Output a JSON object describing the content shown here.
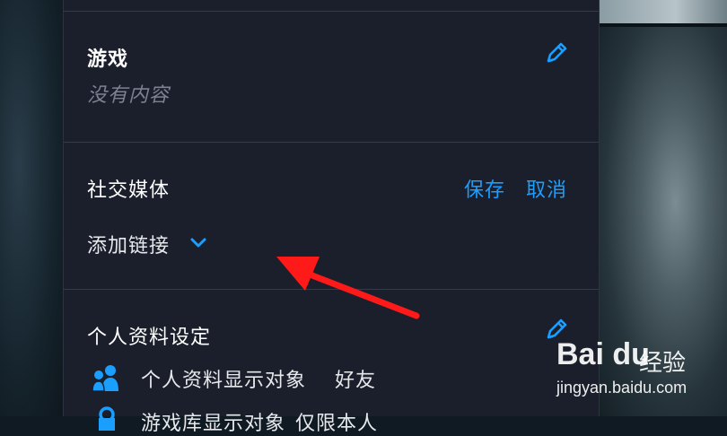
{
  "games": {
    "title": "游戏",
    "empty_text": "没有内容"
  },
  "social_media": {
    "title": "社交媒体",
    "save_label": "保存",
    "cancel_label": "取消",
    "add_link_label": "添加链接"
  },
  "profile_settings": {
    "title": "个人资料设定",
    "visibility_label": "个人资料显示对象",
    "visibility_value": "好友",
    "inventory_label": "游戏库显示对象",
    "inventory_value": "仅限本人"
  },
  "watermark": {
    "logo": "Bai du",
    "sub": "经验",
    "url": "jingyan.baidu.com"
  },
  "colors": {
    "panel_bg": "#1b1f2b",
    "accent": "#1a9fff",
    "arrow": "#ff1a1a"
  },
  "icons": [
    "edit-pencil-icon",
    "chevron-down-icon",
    "friends-icon",
    "lock-icon"
  ]
}
